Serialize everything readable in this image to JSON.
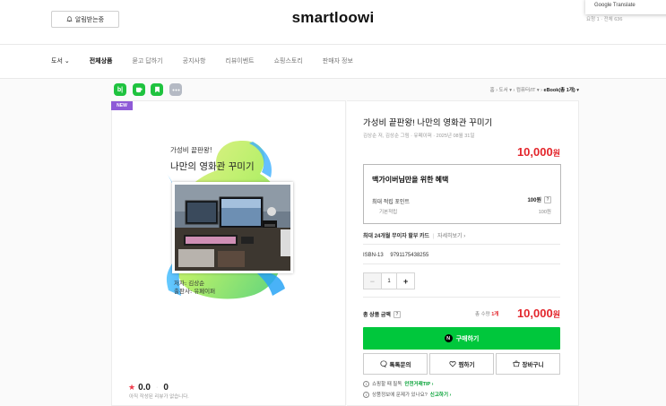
{
  "header": {
    "notify_label": "알림받는중",
    "store_name": "smartloowi",
    "google_translate": "Google Translate",
    "pager": "요청 1 · 전체 636"
  },
  "nav": {
    "items": [
      {
        "label": "도서 ⌄"
      },
      {
        "label": "전체상품"
      },
      {
        "label": "묻고 답하기"
      },
      {
        "label": "공지사항"
      },
      {
        "label": "리뷰이벤트"
      },
      {
        "label": "쇼핑스토리"
      },
      {
        "label": "판매자 정보"
      }
    ]
  },
  "share": {
    "blog": "b|",
    "add": "+"
  },
  "breadcrumb": {
    "path": "홈 › 도서 ▾ › 컴퓨터/IT ▾ › ",
    "current": "eBook(총 1개) ▾"
  },
  "product": {
    "badge": "NEW",
    "cover_subtitle": "가성비 끝판왕!",
    "cover_title": "나만의 영화관 꾸미기",
    "cover_author": "저자: 김상순",
    "cover_publisher": "출판사: 유페이퍼",
    "title": "가성비 끝판왕! 나만의 영화관 꾸미기",
    "meta": "김상순 저, 김상순 그림 · 유페이퍼 · 2025년 08월 31일",
    "price_num": "10,000",
    "price_unit": "원",
    "rating_value": "0.0",
    "review_count": "0",
    "no_review": "아직 작성된 리뷰가 없습니다."
  },
  "benefit": {
    "heading": "맥가이버님만을 위한 혜택",
    "max_points_label": "최대 적립 포인트",
    "max_points_value": "100원",
    "base_label": "기본적립",
    "base_value": "100원"
  },
  "install": {
    "text": "최대 24개월 무이자 할부 카드",
    "link": "자세히보기 ›"
  },
  "isbn": {
    "label": "ISBN-13",
    "value": "9791175438255"
  },
  "quantity": {
    "value": "1",
    "minus": "−",
    "plus": "+"
  },
  "total": {
    "label": "총 상품 금액",
    "count_prefix": "총 수량 ",
    "count_value": "1개",
    "amount_num": "10,000",
    "amount_unit": "원"
  },
  "actions": {
    "buy": "구매하기",
    "talk": "톡톡문의",
    "wish": "찜하기",
    "cart": "장바구니"
  },
  "notes": {
    "safe_prefix": "쇼핑할 때 필독",
    "safe_link": "안전거래TIP ›",
    "report_prefix": "상품정보에 문제가 있나요?",
    "report_link": "신고하기 ›"
  },
  "colors": {
    "accent_green": "#00c73c",
    "price_red": "#e3262c",
    "new_badge": "#8e5ad7"
  }
}
